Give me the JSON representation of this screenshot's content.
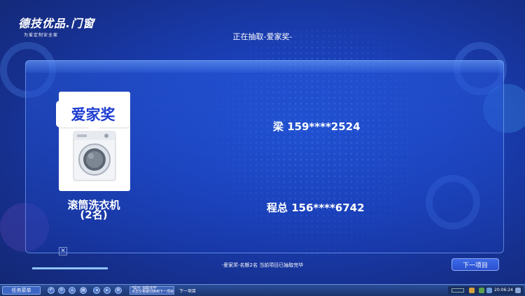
{
  "logo": {
    "title": "德技优品.门窗",
    "slogan": "为爱定制安全家"
  },
  "header": {
    "status_title": "正在抽取-爱家奖-"
  },
  "prize": {
    "badge": "爱家奖",
    "name": "滚筒洗衣机",
    "count": "(2名)",
    "image": "washing-machine"
  },
  "winners": [
    {
      "text": "梁 159****2524"
    },
    {
      "text": "程总 156****6742"
    }
  ],
  "footer": {
    "summary": "-爱家奖-名额2名 当前项目已抽取完毕",
    "next_button": "下一项目",
    "progress": 1.0
  },
  "taskbar": {
    "start_label": "任务菜单",
    "window_line1": "*提示: 抽取完毕",
    "window_line2": "点击空格键切换到下一项目",
    "item": "下一项目",
    "clock": "20:06:24"
  },
  "colors": {
    "background": "#1a3fb8",
    "accent": "#1c3bd1",
    "card": "#ffffff"
  }
}
